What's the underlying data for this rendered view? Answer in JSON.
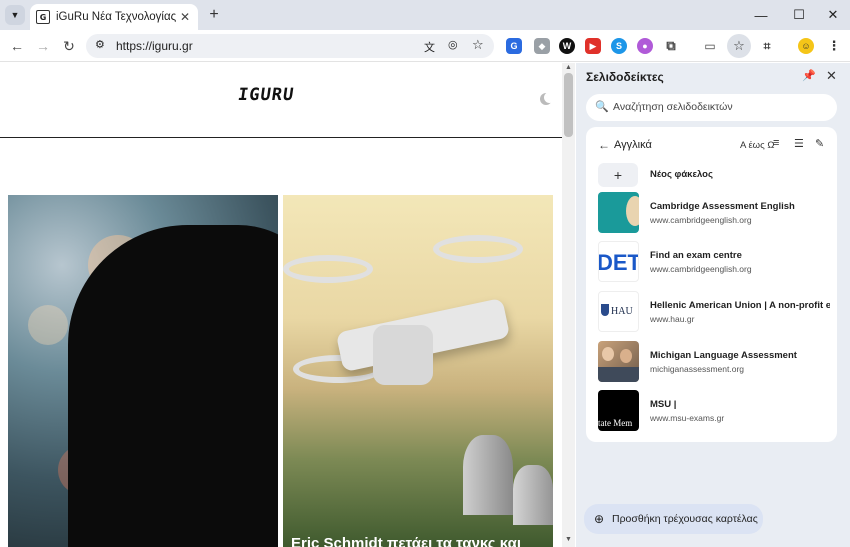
{
  "browser": {
    "tab_title": "iGuRu Νέα Τεχνολογίας σε πρ",
    "url": "https://iguru.gr"
  },
  "site": {
    "logo": "IGURU",
    "article_caption": "Eric Schmidt πετάει τα τανκς και"
  },
  "panel": {
    "title": "Σελιδοδείκτες",
    "search_placeholder": "Αναζήτηση σελιδοδεικτών",
    "folder_name": "Αγγλικά",
    "sort_label": "Α έως Ω",
    "new_folder_label": "Νέος φάκελος",
    "add_tab_label": "Προσθήκη τρέχουσας καρτέλας",
    "bookmarks": [
      {
        "title": "Cambridge Assessment English",
        "url": "www.cambridgeenglish.org",
        "thumb": "teal"
      },
      {
        "title": "Find an exam centre",
        "url": "www.cambridgeenglish.org",
        "thumb": "DET"
      },
      {
        "title": "Hellenic American Union | A non-profit ed...",
        "url": "www.hau.gr",
        "thumb": "HAU"
      },
      {
        "title": "Michigan Language Assessment",
        "url": "michiganassessment.org",
        "thumb": "photo"
      },
      {
        "title": "MSU |",
        "url": "www.msu-exams.gr",
        "thumb": "tate Mem"
      }
    ]
  },
  "colors": {
    "titlebar": "#dfe3eb",
    "panel_bg": "#e9edf3",
    "add_tab_bg": "#dbe3f3",
    "accent_teal": "#1a9a9a"
  }
}
